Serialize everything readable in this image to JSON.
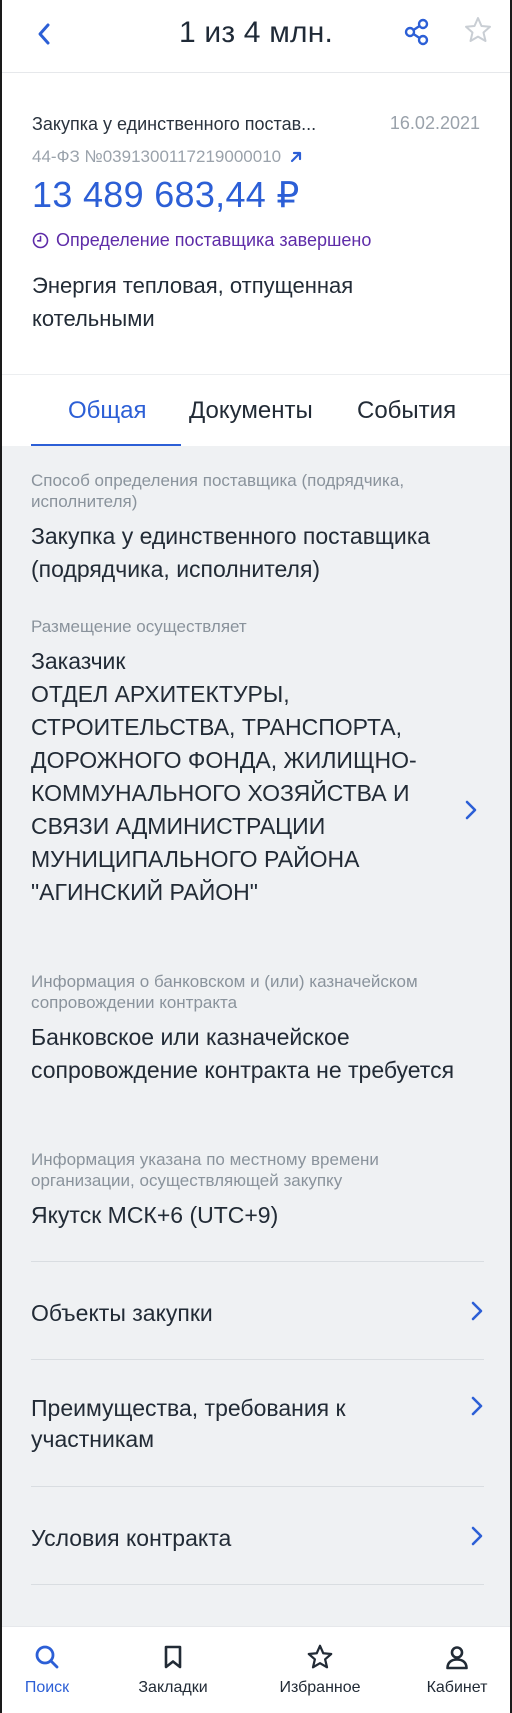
{
  "header": {
    "title": "1 из 4 млн."
  },
  "summary": {
    "method": "Закупка у единственного постав...",
    "date": "16.02.2021",
    "reg_number": "44-ФЗ №0391300117219000010",
    "price": "13 489 683,44 ₽",
    "status": "Определение поставщика завершено",
    "subject": "Энергия тепловая, отпущенная котельными"
  },
  "tabs": [
    {
      "label": "Общая",
      "active": true
    },
    {
      "label": "Документы",
      "active": false
    },
    {
      "label": "События",
      "active": false
    }
  ],
  "fields": {
    "method_label": "Способ определения поставщика (подрядчика, исполнителя)",
    "method_value": "Закупка у единственного поставщика (подрядчика, исполнителя)",
    "placer_label": "Размещение осуществляет",
    "placer_role": "Заказчик",
    "placer_name": "ОТДЕЛ АРХИТЕКТУРЫ, СТРОИТЕЛЬСТВА, ТРАНСПОРТА, ДОРОЖНОГО ФОНДА, ЖИЛИЩНО-КОММУНАЛЬНОГО ХОЗЯЙСТВА И СВЯЗИ АДМИНИСТРАЦИИ МУНИЦИПАЛЬНОГО РАЙОНА \"АГИНСКИЙ РАЙОН\"",
    "bank_label": "Информация о банковском и (или) казначейском сопровождении контракта",
    "bank_value": "Банковское или казначейское сопровождение контракта не требуется",
    "tz_label": "Информация указана по местному времени организации, осуществляющей закупку",
    "tz_value": "Якутск МСК+6 (UTC+9)"
  },
  "nav_rows": [
    {
      "label": "Объекты закупки"
    },
    {
      "label": "Преимущества, требования к участникам"
    },
    {
      "label": "Условия контракта"
    }
  ],
  "bottom_nav": [
    {
      "label": "Поиск",
      "icon": "search-icon",
      "active": true
    },
    {
      "label": "Закладки",
      "icon": "bookmark-icon",
      "active": false
    },
    {
      "label": "Избранное",
      "icon": "star-icon",
      "active": false
    },
    {
      "label": "Кабинет",
      "icon": "user-icon",
      "active": false
    }
  ],
  "colors": {
    "accent": "#2c5fd6",
    "status": "#5e2ca8",
    "muted": "#8a939c",
    "content_bg": "#eff1f3"
  }
}
